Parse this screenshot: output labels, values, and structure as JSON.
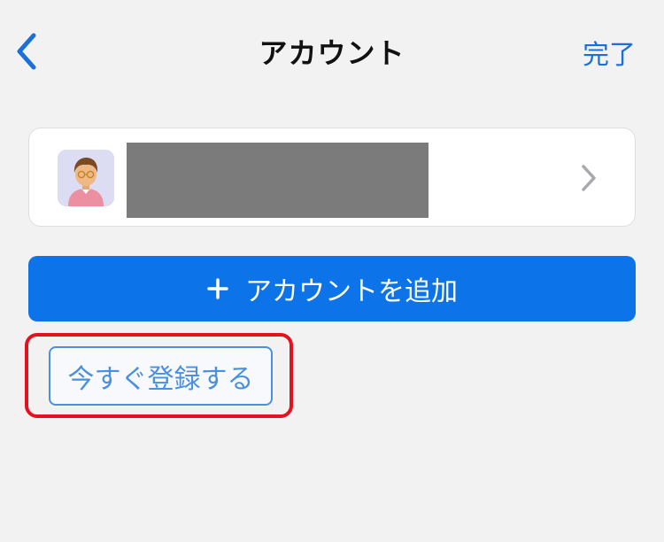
{
  "navbar": {
    "back_icon": "chevron-left-icon",
    "title": "アカウント",
    "done_label": "完了"
  },
  "account": {
    "avatar_icon": "user-avatar-icon",
    "chevron_icon": "chevron-right-icon"
  },
  "add_account": {
    "plus_icon": "plus-icon",
    "label": "アカウントを追加"
  },
  "register": {
    "label": "今すぐ登録する"
  },
  "colors": {
    "background": "#f2f2f2",
    "accent_blue": "#0c74e8",
    "link_blue": "#1a6fd8",
    "highlight_red": "#e3121e",
    "redaction_gray": "#7b7b7b"
  }
}
